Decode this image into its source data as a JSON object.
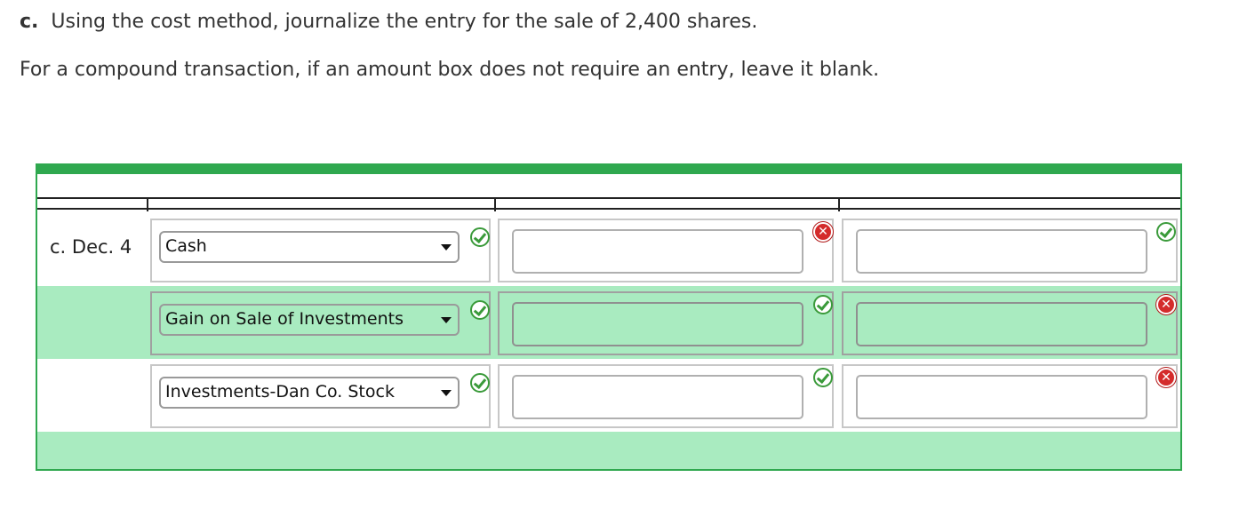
{
  "question": {
    "label": "c.",
    "text": "Using the cost method, journalize the entry for the sale of 2,400 shares.",
    "note": "For a compound transaction, if an amount box does not require an entry, leave it blank."
  },
  "journal": {
    "rows": [
      {
        "date": "c. Dec. 4",
        "account": "Cash",
        "debit": "",
        "credit": "",
        "account_status": "correct",
        "debit_status": "incorrect",
        "credit_status": "correct"
      },
      {
        "date": "",
        "account": "Gain on Sale of Investments",
        "debit": "",
        "credit": "",
        "account_status": "correct",
        "debit_status": "correct",
        "credit_status": "incorrect"
      },
      {
        "date": "",
        "account": "Investments-Dan Co. Stock",
        "debit": "",
        "credit": "",
        "account_status": "correct",
        "debit_status": "correct",
        "credit_status": "incorrect"
      }
    ]
  },
  "colors": {
    "accent_green": "#2fa84f",
    "row_alt": "#a9ebc0",
    "error_red": "#d42b2b"
  }
}
